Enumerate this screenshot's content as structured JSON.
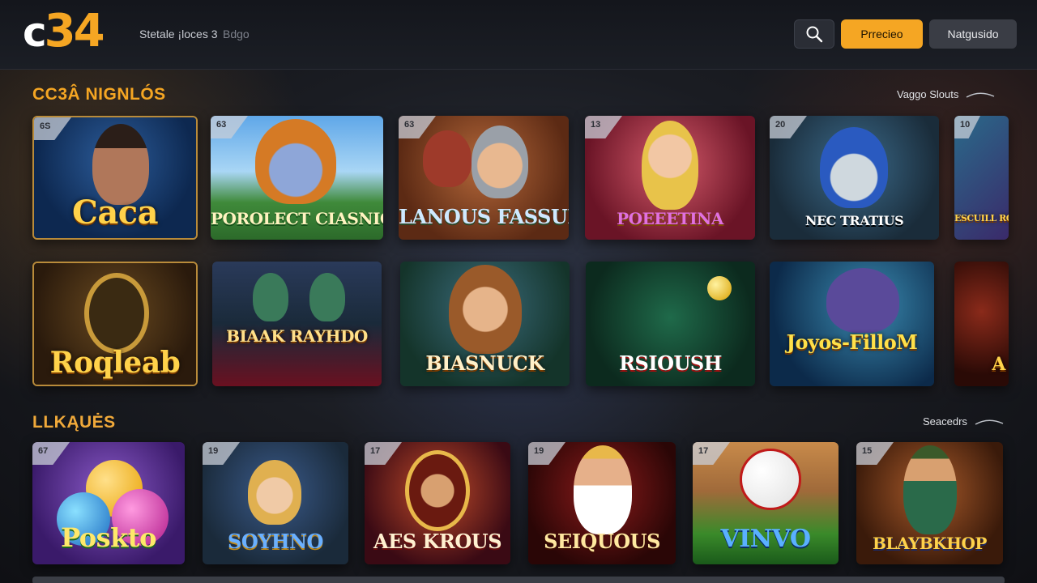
{
  "header": {
    "logo_letter": "c",
    "logo_number": "34",
    "nav_primary": "Stetale ¡loces 3",
    "nav_secondary": "Bdgo",
    "search_icon": "search-icon",
    "login_label": "Prrecieo",
    "register_label": "Natgusido"
  },
  "sections": [
    {
      "title": "CC3Â NIGNLÓS",
      "see_all": "Vaggo Slouts",
      "rows": [
        [
          {
            "badge": "6S",
            "title": "Caca"
          },
          {
            "badge": "63",
            "title": "POROLECT CIASNIOCU"
          },
          {
            "badge": "63",
            "title": "LANOUS FASSUINO"
          },
          {
            "badge": "13",
            "title": "POEEETINA"
          },
          {
            "badge": "20",
            "title": "NEC TRATIUS"
          },
          {
            "badge": "10",
            "title": "ESCUILL RONTORS"
          }
        ],
        [
          {
            "badge": "",
            "title": "Roqleab"
          },
          {
            "badge": "",
            "title": "BIAAK RAYHDO"
          },
          {
            "badge": "",
            "title": "BIASNUCK"
          },
          {
            "badge": "",
            "title": "RSIOUSH"
          },
          {
            "badge": "",
            "title": "Joyos-FilloM"
          },
          {
            "badge": "",
            "title": "A"
          }
        ]
      ]
    },
    {
      "title": "LLKĄUĖS",
      "see_all": "Seacedrs",
      "rows": [
        [
          {
            "badge": "67",
            "title": "Poskto"
          },
          {
            "badge": "19",
            "title": "SOYHNO"
          },
          {
            "badge": "17",
            "title": "AES KROUS"
          },
          {
            "badge": "19",
            "title": "SEIQUOUS"
          },
          {
            "badge": "17",
            "title": "VINVO"
          },
          {
            "badge": "15",
            "title": "BLAYBKHOP"
          }
        ]
      ]
    }
  ],
  "colors": {
    "accent": "#f5a623",
    "background": "#1a1c22",
    "button_secondary": "#3a3d45"
  }
}
